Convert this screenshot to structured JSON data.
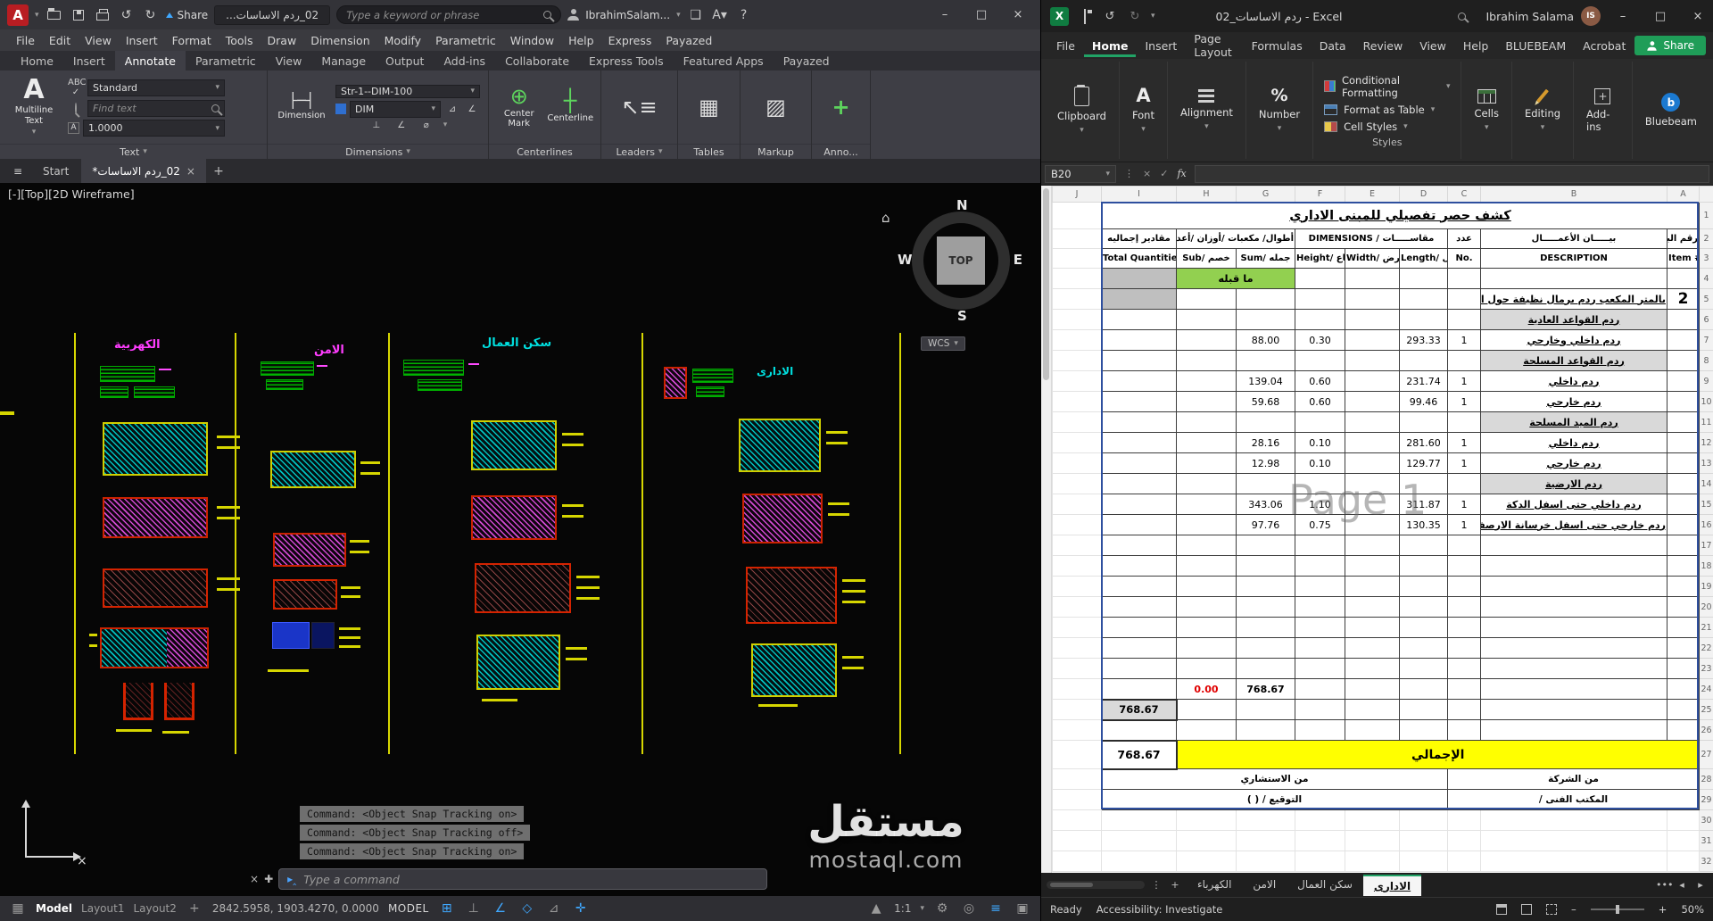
{
  "autocad": {
    "titlebar": {
      "share": "Share",
      "filename": "02_ردم الاساسات...",
      "search_placeholder": "Type a keyword or phrase",
      "user": "IbrahimSalam..."
    },
    "menubar": {
      "items": [
        "File",
        "Edit",
        "View",
        "Insert",
        "Format",
        "Tools",
        "Draw",
        "Dimension",
        "Modify",
        "Parametric",
        "Window",
        "Help",
        "Express",
        "Payazed"
      ]
    },
    "ribbon": {
      "tabs": [
        "Home",
        "Insert",
        "Annotate",
        "Parametric",
        "View",
        "Manage",
        "Output",
        "Add-ins",
        "Collaborate",
        "Express Tools",
        "Featured Apps",
        "Payazed"
      ],
      "active_tab": "Annotate",
      "text_panel": {
        "label": "Text",
        "tool": "Multiline Text",
        "style": "Standard",
        "find_placeholder": "Find text",
        "text_height": "1.0000"
      },
      "dimension_panel": {
        "label": "Dimensions",
        "tool": "Dimension",
        "style": "Str-1--DIM-100",
        "dim_layer": "DIM"
      },
      "centerlines_panel": {
        "label": "Centerlines",
        "center_mark": "Center Mark",
        "centerline": "Centerline"
      },
      "leaders_panel": {
        "label": "Leaders"
      },
      "tables_panel": {
        "label": "Tables"
      },
      "markup_panel": {
        "label": "Markup"
      },
      "anno_panel": {
        "label": "Anno..."
      }
    },
    "file_tabs": {
      "start": "Start",
      "drawing": "02_ردم الاساسات*"
    },
    "viewport": {
      "label": "[-][Top][2D Wireframe]",
      "compass": {
        "n": "N",
        "s": "S",
        "e": "E",
        "w": "W",
        "top": "TOP",
        "wcs": "WCS"
      },
      "sections": {
        "s1": "الكهربية",
        "s2": "الامن",
        "s3": "سكن العمال",
        "s4": "الادارى"
      }
    },
    "command_line": {
      "history": [
        "Command:  <Object Snap Tracking on>",
        "Command:  <Object Snap Tracking off>",
        "Command:  <Object Snap Tracking on>"
      ],
      "input_placeholder": "Type a command"
    },
    "statusbar": {
      "model": "Model",
      "layout1": "Layout1",
      "layout2": "Layout2",
      "coordinates": "2842.5958, 1903.4270, 0.0000",
      "mode": "MODEL",
      "scale": "1:1"
    },
    "watermark": {
      "arabic": "مستقل",
      "latin": "mostaql.com"
    }
  },
  "excel": {
    "titlebar": {
      "filename": "ردم الاساسات_02 - Excel",
      "user": "Ibrahim Salama",
      "initials": "IS"
    },
    "menu": {
      "items": [
        "File",
        "Home",
        "Insert",
        "Page Layout",
        "Formulas",
        "Data",
        "Review",
        "View",
        "Help",
        "BLUEBEAM",
        "Acrobat"
      ],
      "active": "Home",
      "share": "Share"
    },
    "ribbon": {
      "clipboard": "Clipboard",
      "font": "Font",
      "alignment": "Alignment",
      "number": "Number",
      "conditional_formatting": "Conditional Formatting",
      "format_as_table": "Format as Table",
      "cell_styles": "Cell Styles",
      "styles_label": "Styles",
      "cells": "Cells",
      "editing": "Editing",
      "addins": "Add-ins",
      "bluebeam": "Bluebeam"
    },
    "formula_bar": {
      "name_box": "B20",
      "fx": "fx"
    },
    "watermark": "Page 1",
    "sheet": {
      "col_letters": [
        "J",
        "I",
        "H",
        "G",
        "F",
        "E",
        "D",
        "C",
        "B",
        "A"
      ],
      "table": {
        "title": "كشف حصر تفصيلي للمبنى الاداري",
        "header1": {
          "total": "مقادير إجماليه",
          "subsum": "أطوال/ مكعبات /أوزان /أعداد",
          "dims": "DIMENSIONS  /  مقاســـــات",
          "no": "عدد",
          "desc": "بيـــــان  الأعمـــــال",
          "item": "رقم البند"
        },
        "header2": {
          "total": "Total Quantities",
          "sub": "Sub/ خصم",
          "sum": "Sum/ جمله",
          "height": "Height/ ارتفاع",
          "width": "Width/ عرض",
          "length": "Length/ طول",
          "no": "No.",
          "desc": "DESCRIPTION",
          "item": "Item #"
        },
        "rows": [
          {
            "t": "prev",
            "label": "ما قبله"
          },
          {
            "t": "item",
            "item": "2",
            "desc": "بالمتر المكعب ردم برمال نظيفة حول الاساسات :-"
          },
          {
            "t": "sec",
            "desc": "ردم  القواعد العادية"
          },
          {
            "t": "d",
            "desc": "ردم داخلي وخارجي",
            "no": "1",
            "len": "293.33",
            "h": "0.30",
            "sum": "88.00"
          },
          {
            "t": "sec",
            "desc": "ردم القواعد المسلحة"
          },
          {
            "t": "d",
            "desc": "ردم داخلي",
            "no": "1",
            "len": "231.74",
            "h": "0.60",
            "sum": "139.04"
          },
          {
            "t": "d",
            "desc": "ردم خارجي",
            "no": "1",
            "len": "99.46",
            "h": "0.60",
            "sum": "59.68"
          },
          {
            "t": "sec",
            "desc": "ردم الميد المسلحة"
          },
          {
            "t": "d",
            "desc": "ردم داخلي",
            "no": "1",
            "len": "281.60",
            "h": "0.10",
            "sum": "28.16"
          },
          {
            "t": "d",
            "desc": "ردم خارجي",
            "no": "1",
            "len": "129.77",
            "h": "0.10",
            "sum": "12.98"
          },
          {
            "t": "sec",
            "desc": "ردم الارضية"
          },
          {
            "t": "d",
            "desc": "ردم داخلي حتى اسفل الدكة",
            "no": "1",
            "len": "311.87",
            "h": "1.10",
            "sum": "343.06"
          },
          {
            "t": "d",
            "desc": "ردم خارجي حتى اسفل خرسانة الارصفة",
            "no": "1",
            "len": "130.35",
            "h": "0.75",
            "sum": "97.76"
          },
          {
            "t": "e"
          },
          {
            "t": "e"
          },
          {
            "t": "e"
          },
          {
            "t": "e"
          },
          {
            "t": "e"
          },
          {
            "t": "e"
          },
          {
            "t": "e"
          },
          {
            "t": "subtotal",
            "sub": "0.00",
            "sum": "768.67"
          },
          {
            "t": "total",
            "total": "768.67"
          },
          {
            "t": "e"
          },
          {
            "t": "grand",
            "label": "الإجمالي",
            "total": "768.67"
          },
          {
            "t": "sign",
            "left": "من الاستشاري",
            "right": "من الشركة"
          },
          {
            "t": "sign",
            "left": "التوقيع /  (            )",
            "right": "المكتب الفنى /"
          }
        ]
      }
    },
    "sheet_tabs": {
      "tabs": [
        "الكهرباء",
        "الامن",
        "سكن العمال",
        "الادارى"
      ],
      "active": "الادارى"
    },
    "statusbar": {
      "ready": "Ready",
      "accessibility": "Accessibility: Investigate",
      "zoom": "50%"
    }
  }
}
